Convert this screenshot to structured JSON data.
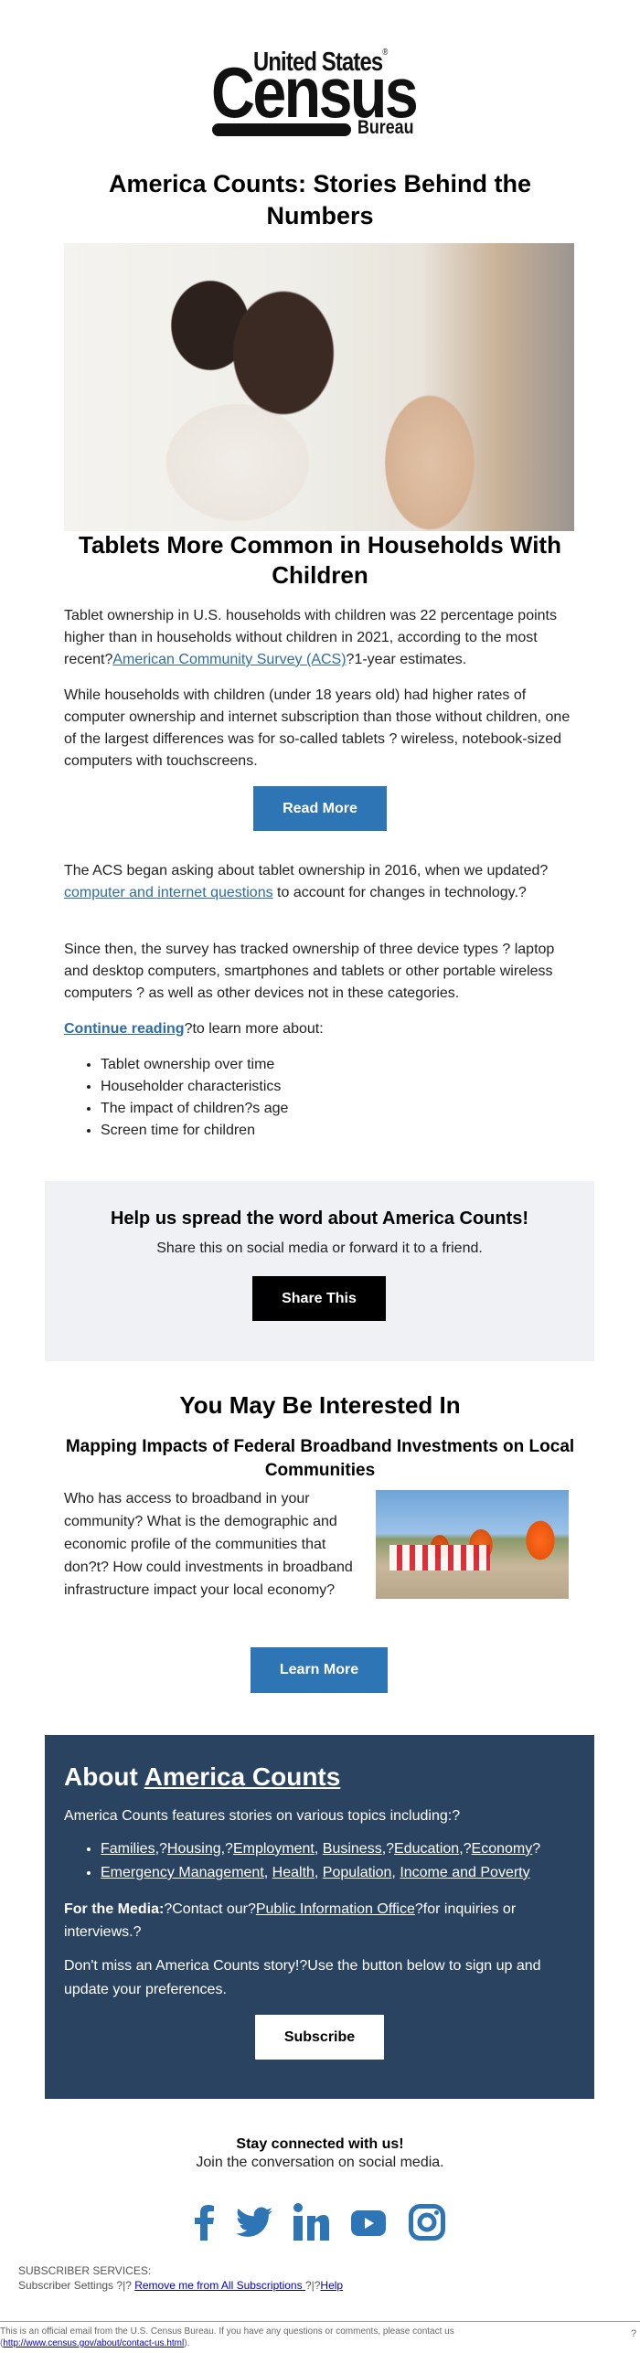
{
  "logo": {
    "line1": "United States",
    "line2": "Census",
    "line3": "Bureau",
    "registered": "®"
  },
  "header": {
    "title": "America Counts: Stories Behind the Numbers"
  },
  "article": {
    "heading": "Tablets More Common in Households With Children",
    "p1_before": "Tablet ownership in U.S. households with children was 22 percentage points higher than in households without children in 2021, according to the most recent?",
    "p1_link": "American Community Survey (ACS)",
    "p1_after": "?1-year estimates.",
    "p2": "While households with children (under 18 years old) had higher rates of computer ownership and internet subscription than those without children, one of the largest differences was for so-called tablets ? wireless, notebook-sized computers with touchscreens.",
    "read_more": "Read More",
    "p3_before": "The ACS began asking about tablet ownership in 2016, when we updated?",
    "p3_link": "computer and internet questions",
    "p3_after": " to account for changes in technology.?",
    "p4": "Since then, the survey has tracked ownership of three device types ? laptop and desktop computers, smartphones and tablets or other portable wireless computers ? as well as other devices not in these categories.",
    "continue_link": "Continue reading",
    "continue_after": "?to learn more about:",
    "bullets": [
      "Tablet ownership over time",
      "Householder characteristics",
      "The impact of children?s age",
      "Screen time for children"
    ]
  },
  "share": {
    "heading": "Help us spread the word about America Counts!",
    "sub": "Share this on social media or forward it to a friend.",
    "button": "Share This"
  },
  "interested": {
    "heading": "You May Be Interested In",
    "story_title": "Mapping Impacts of Federal Broadband Investments on Local Communities",
    "story_body": "Who has access to broadband in your community? What is the demographic and economic profile of the communities that don?t? How could investments in broadband infrastructure impact your local economy?",
    "button": "Learn More"
  },
  "about": {
    "heading_prefix": "About ",
    "heading_link": "America Counts",
    "intro": "America Counts features stories on various topics including:?",
    "topics_line1": [
      {
        "label": "Families",
        "sep": ",?"
      },
      {
        "label": "Housing",
        "sep": ",?"
      },
      {
        "label": "Employment",
        "sep": ", "
      },
      {
        "label": "Business",
        "sep": ",?"
      },
      {
        "label": "Education",
        "sep": ",?"
      },
      {
        "label": "Economy",
        "sep": "?"
      }
    ],
    "topics_line2": [
      {
        "label": "Emergency Management",
        "sep": ", "
      },
      {
        "label": "Health",
        "sep": ", "
      },
      {
        "label": "Population",
        "sep": ", "
      },
      {
        "label": "Income and Poverty",
        "sep": ""
      }
    ],
    "media_label": "For the Media:",
    "media_before": "?Contact our?",
    "media_link": "Public Information Office",
    "media_after": "?for inquiries or interviews.?",
    "dont_miss": "Don't miss an America Counts story!?Use the button below to sign up and update your preferences.",
    "subscribe": "Subscribe"
  },
  "social": {
    "heading": "Stay connected with us!",
    "sub": "Join the conversation on social media.",
    "icons": [
      "facebook-icon",
      "twitter-icon",
      "linkedin-icon",
      "youtube-icon",
      "instagram-icon"
    ],
    "color": "#2e75b6"
  },
  "subscriber": {
    "label": "SUBSCRIBER SERVICES:",
    "settings": "Subscriber Settings",
    "sep1": " ?|? ",
    "remove": "Remove me from All Subscriptions ",
    "sep2": "?|?",
    "help": "Help"
  },
  "footer": {
    "text": "This is an official email from the U.S. Census Bureau. If you have any questions or comments, please contact us",
    "link": "http://www.census.gov/about/contact-us.html",
    "open": "(",
    "close": ").",
    "trailing": "?"
  },
  "colors": {
    "button_blue": "#2e75b6",
    "dark_panel": "#2a4361",
    "share_panel": "#eff1f4",
    "link": "#2e6da4"
  }
}
